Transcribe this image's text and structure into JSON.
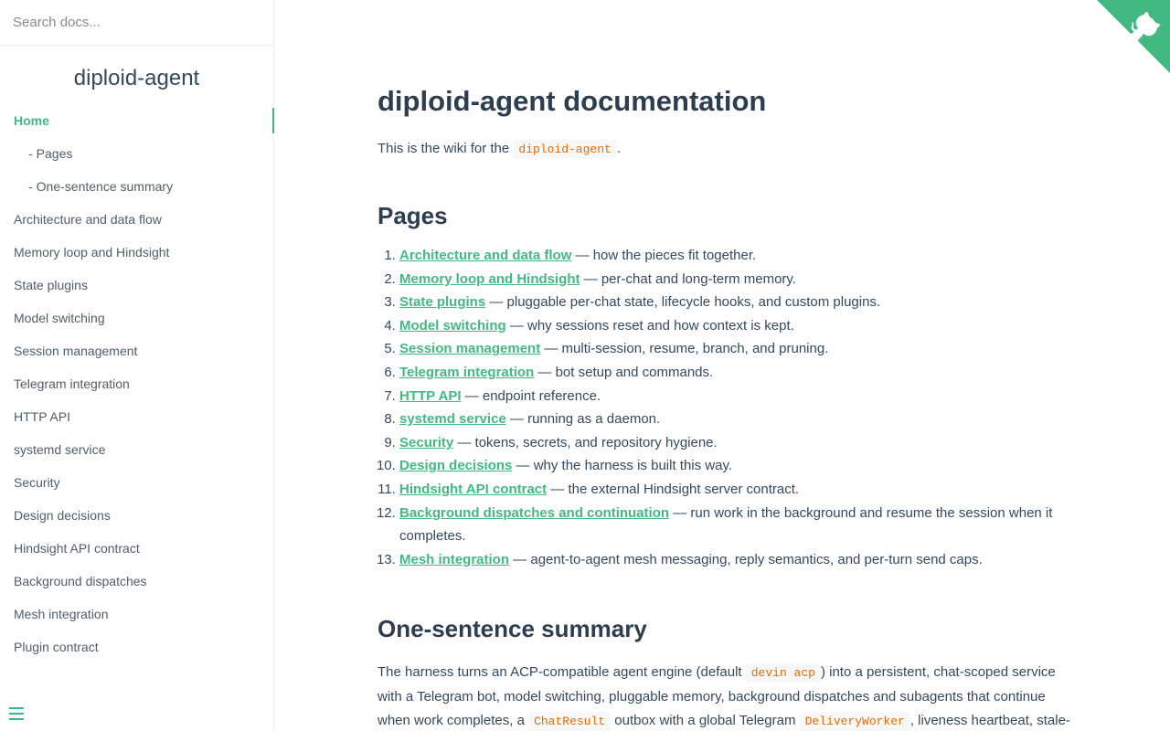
{
  "search": {
    "placeholder": "Search docs..."
  },
  "sidebar": {
    "app_name": "diploid-agent",
    "items": [
      {
        "label": "Home",
        "active": true,
        "sub": false
      },
      {
        "label": "Pages",
        "active": false,
        "sub": true
      },
      {
        "label": "One-sentence summary",
        "active": false,
        "sub": true
      },
      {
        "label": "Architecture and data flow",
        "active": false,
        "sub": false
      },
      {
        "label": "Memory loop and Hindsight",
        "active": false,
        "sub": false
      },
      {
        "label": "State plugins",
        "active": false,
        "sub": false
      },
      {
        "label": "Model switching",
        "active": false,
        "sub": false
      },
      {
        "label": "Session management",
        "active": false,
        "sub": false
      },
      {
        "label": "Telegram integration",
        "active": false,
        "sub": false
      },
      {
        "label": "HTTP API",
        "active": false,
        "sub": false
      },
      {
        "label": "systemd service",
        "active": false,
        "sub": false
      },
      {
        "label": "Security",
        "active": false,
        "sub": false
      },
      {
        "label": "Design decisions",
        "active": false,
        "sub": false
      },
      {
        "label": "Hindsight API contract",
        "active": false,
        "sub": false
      },
      {
        "label": "Background dispatches",
        "active": false,
        "sub": false
      },
      {
        "label": "Mesh integration",
        "active": false,
        "sub": false
      },
      {
        "label": "Plugin contract",
        "active": false,
        "sub": false
      }
    ],
    "sub_dash": "-"
  },
  "main": {
    "title": "diploid-agent documentation",
    "intro": {
      "before": "This is the wiki for the ",
      "code": "diploid-agent",
      "after": "."
    },
    "pages_heading": "Pages",
    "pages": [
      {
        "link": "Architecture and data flow",
        "desc": " — how the pieces fit together."
      },
      {
        "link": "Memory loop and Hindsight",
        "desc": " — per-chat and long-term memory."
      },
      {
        "link": "State plugins",
        "desc": " — pluggable per-chat state, lifecycle hooks, and custom plugins."
      },
      {
        "link": "Model switching",
        "desc": " — why sessions reset and how context is kept."
      },
      {
        "link": "Session management",
        "desc": " — multi-session, resume, branch, and pruning."
      },
      {
        "link": "Telegram integration",
        "desc": " — bot setup and commands."
      },
      {
        "link": "HTTP API",
        "desc": " — endpoint reference."
      },
      {
        "link": "systemd service",
        "desc": " — running as a daemon."
      },
      {
        "link": "Security",
        "desc": " — tokens, secrets, and repository hygiene."
      },
      {
        "link": "Design decisions",
        "desc": " — why the harness is built this way."
      },
      {
        "link": "Hindsight API contract",
        "desc": " — the external Hindsight server contract."
      },
      {
        "link": "Background dispatches and continuation",
        "desc": " — run work in the background and resume the session when it completes."
      },
      {
        "link": "Mesh integration",
        "desc": " — agent-to-agent mesh messaging, reply semantics, and per-turn send caps."
      }
    ],
    "summary_heading": "One-sentence summary",
    "summary": {
      "t1": "The harness turns an ACP-compatible agent engine (default ",
      "c1": "devin acp",
      "t2": ") into a persistent, chat-scoped service with a Telegram bot, model switching, pluggable memory, background dispatches and subagents that continue when work completes, a ",
      "c2": "ChatResult",
      "t3": " outbox with a global Telegram ",
      "c3": "DeliveryWorker",
      "t4": ", liveness heartbeat, stale-wake"
    }
  },
  "colors": {
    "accent": "#42b983",
    "text": "#34495e",
    "heading": "#2c3e50",
    "code": "#e96900"
  },
  "icons": {
    "menu": "hamburger-icon",
    "corner": "github-corner-icon"
  }
}
